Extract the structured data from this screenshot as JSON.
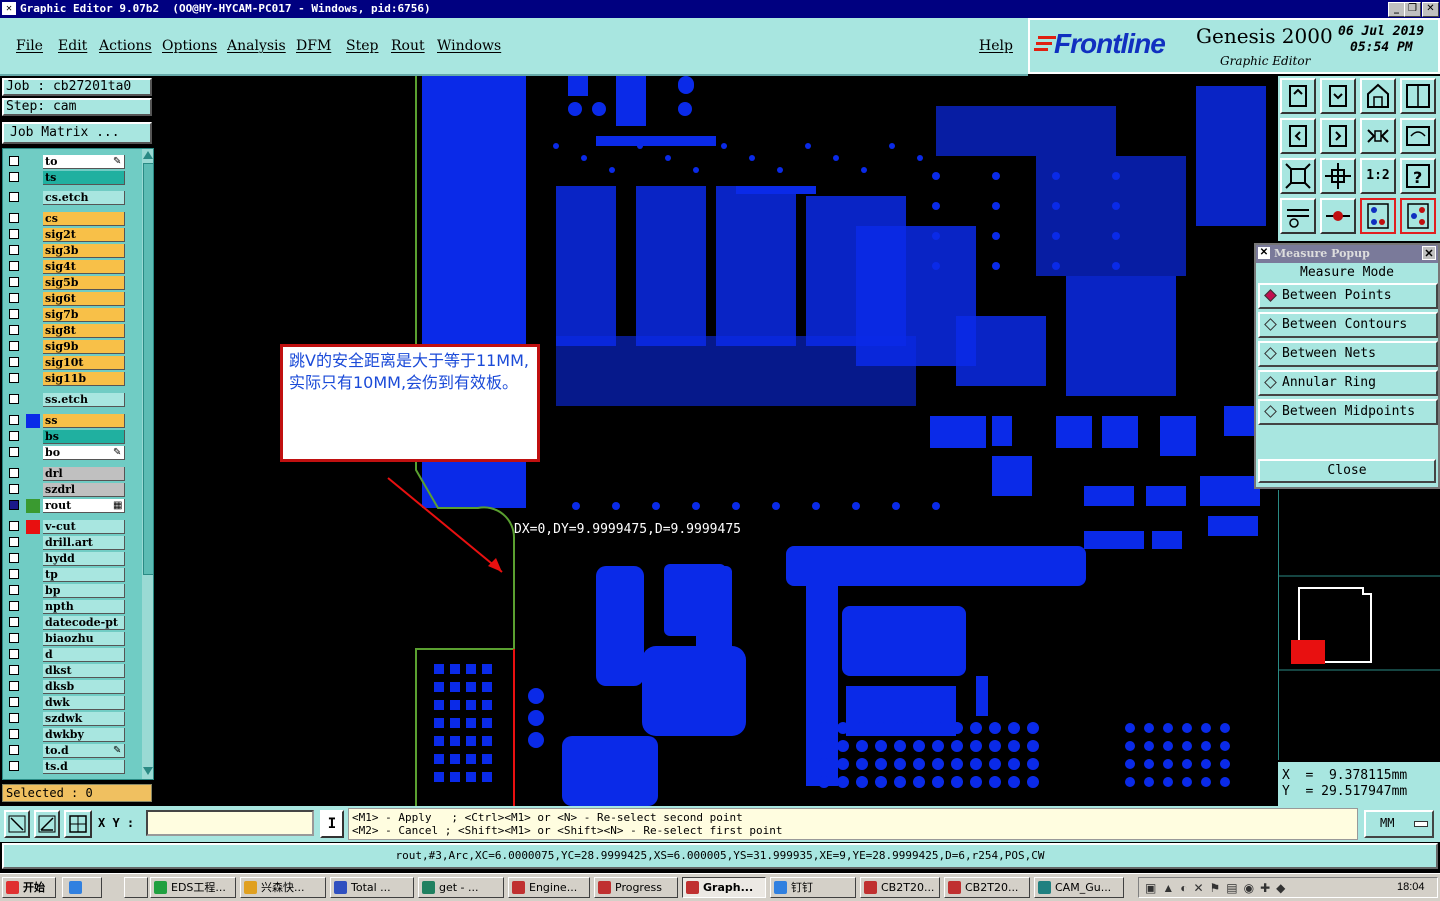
{
  "window": {
    "title": "Graphic Editor 9.07b2  (OO@HY-HYCAM-PC017 - Windows, pid:6756)",
    "controls": [
      "_",
      "❐",
      "✕"
    ]
  },
  "menu": {
    "items": [
      "File",
      "Edit",
      "Actions",
      "Options",
      "Analysis",
      "DFM",
      "Step",
      "Rout",
      "Windows"
    ],
    "help": "Help"
  },
  "brand": {
    "logo": "Frontline",
    "product": "Genesis 2000",
    "subtitle": "Graphic Editor",
    "date": "06 Jul 2019",
    "time": "05:54 PM"
  },
  "job": {
    "job_label": "Job : cb27201ta0",
    "step_label": "Step: cam",
    "matrix_button": "Job Matrix ..."
  },
  "layers": [
    {
      "name": "to",
      "color": "#ffffff",
      "swatch": "",
      "icon": "✎"
    },
    {
      "name": "ts",
      "color": "#20b0a0",
      "swatch": ""
    },
    {
      "name": "cs.etch",
      "color": "#a8e6e0",
      "swatch": ""
    },
    {
      "name": "cs",
      "color": "#f8c048",
      "swatch": ""
    },
    {
      "name": "sig2t",
      "color": "#f8c048",
      "swatch": ""
    },
    {
      "name": "sig3b",
      "color": "#f8c048",
      "swatch": ""
    },
    {
      "name": "sig4t",
      "color": "#f8c048",
      "swatch": ""
    },
    {
      "name": "sig5b",
      "color": "#f8c048",
      "swatch": ""
    },
    {
      "name": "sig6t",
      "color": "#f8c048",
      "swatch": ""
    },
    {
      "name": "sig7b",
      "color": "#f8c048",
      "swatch": ""
    },
    {
      "name": "sig8t",
      "color": "#f8c048",
      "swatch": ""
    },
    {
      "name": "sig9b",
      "color": "#f8c048",
      "swatch": ""
    },
    {
      "name": "sig10t",
      "color": "#f8c048",
      "swatch": ""
    },
    {
      "name": "sig11b",
      "color": "#f8c048",
      "swatch": ""
    },
    {
      "name": "ss.etch",
      "color": "#a8e6e0",
      "swatch": ""
    },
    {
      "name": "ss",
      "color": "#f8c048",
      "swatch": "#0a2ae8"
    },
    {
      "name": "bs",
      "color": "#20b0a0",
      "swatch": ""
    },
    {
      "name": "bo",
      "color": "#ffffff",
      "swatch": "",
      "icon": "✎"
    },
    {
      "name": "drl",
      "color": "#c0c0c0",
      "swatch": ""
    },
    {
      "name": "szdrl",
      "color": "#c0c0c0",
      "swatch": ""
    },
    {
      "name": "rout",
      "color": "#ffffff",
      "swatch": "#3a9a30",
      "icon": "▦"
    },
    {
      "name": "v-cut",
      "color": "#a8e6e0",
      "swatch": "#e81010"
    },
    {
      "name": "drill.art",
      "color": "#a8e6e0",
      "swatch": ""
    },
    {
      "name": "hydd",
      "color": "#a8e6e0",
      "swatch": ""
    },
    {
      "name": "tp",
      "color": "#a8e6e0",
      "swatch": ""
    },
    {
      "name": "bp",
      "color": "#a8e6e0",
      "swatch": ""
    },
    {
      "name": "npth",
      "color": "#a8e6e0",
      "swatch": ""
    },
    {
      "name": "datecode-pt",
      "color": "#a8e6e0",
      "swatch": ""
    },
    {
      "name": "biaozhu",
      "color": "#a8e6e0",
      "swatch": ""
    },
    {
      "name": "d",
      "color": "#a8e6e0",
      "swatch": ""
    },
    {
      "name": "dkst",
      "color": "#a8e6e0",
      "swatch": ""
    },
    {
      "name": "dksb",
      "color": "#a8e6e0",
      "swatch": ""
    },
    {
      "name": "dwk",
      "color": "#a8e6e0",
      "swatch": ""
    },
    {
      "name": "szdwk",
      "color": "#a8e6e0",
      "swatch": ""
    },
    {
      "name": "dwkby",
      "color": "#a8e6e0",
      "swatch": ""
    },
    {
      "name": "to.d",
      "color": "#a8e6e0",
      "swatch": "",
      "icon": "✎"
    },
    {
      "name": "ts.d",
      "color": "#a8e6e0",
      "swatch": ""
    }
  ],
  "selected": "Selected : 0",
  "annotation": {
    "text": "跳V的安全距离是大于等于11MM,实际只有10MM,会伤到有效板。",
    "measure": "DX=0,DY=9.9999475,D=9.9999475"
  },
  "measure_popup": {
    "title": "Measure Popup",
    "mode_label": "Measure Mode",
    "options": [
      "Between Points",
      "Between Contours",
      "Between Nets",
      "Annular Ring",
      "Between Midpoints"
    ],
    "selected_option": "Between Points",
    "close_label": "Close"
  },
  "coords": {
    "x": "X  =  9.378115mm",
    "y": "Y  = 29.517947mm"
  },
  "command": {
    "xy_label": "X Y :",
    "xy_value": "",
    "hint1": "<M1> - Apply   ; <Ctrl><M1> or <N> - Re-select second point",
    "hint2": "<M2> - Cancel ; <Shift><M1> or <Shift><N> - Re-select first point",
    "units": "MM"
  },
  "status_line": "rout,#3,Arc,XC=6.0000075,YC=28.9999425,XS=6.000005,YS=31.999935,XE=9,YE=28.9999425,D=6,r254,POS,CW",
  "taskbar": {
    "start": "开始",
    "items": [
      "EDS工程...",
      "兴森快...",
      "Total ...",
      "get - ...",
      "Engine...",
      "Progress",
      "Graph...",
      "钉钉",
      "CB2T20...",
      "CB2T20...",
      "CAM_Gu..."
    ],
    "clock": "18:04"
  },
  "colors": {
    "panel": "#a8e6e0",
    "copper": "#0a2ae8",
    "rout_outline": "#5aa030",
    "vcut": "#e81010"
  }
}
